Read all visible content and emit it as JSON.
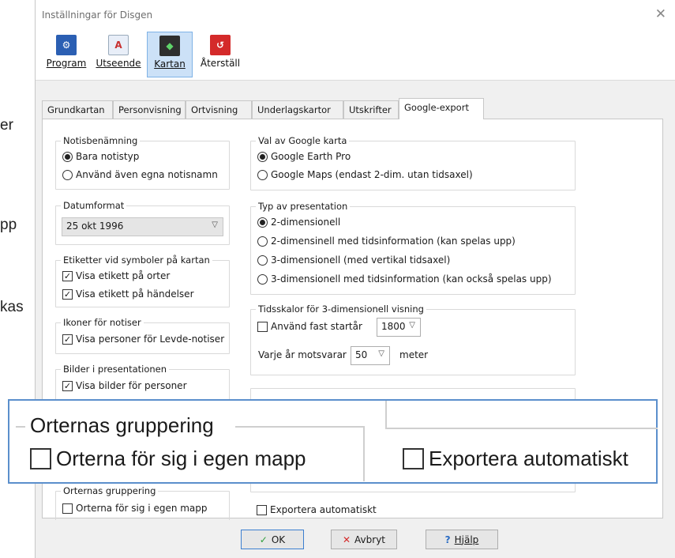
{
  "background_fragments": [
    "er",
    "pp",
    "kas"
  ],
  "window": {
    "title": "Inställningar för Disgen",
    "close_glyph": "✕"
  },
  "toolbar": [
    {
      "label": "Program",
      "icon": "gears-icon",
      "glyph": "⚙",
      "color": "#2b5fb3"
    },
    {
      "label": "Utseende",
      "icon": "appearance-icon",
      "glyph": "A",
      "color": "#c83030"
    },
    {
      "label": "Kartan",
      "icon": "map-icon",
      "glyph": "◆",
      "color": "#1e8a3a",
      "active": true
    },
    {
      "label": "Återställ",
      "icon": "reset-icon",
      "glyph": "↺",
      "color": "#d42a2a"
    }
  ],
  "tabs": [
    "Grundkartan",
    "Personvisning",
    "Ortvisning",
    "Underlagskartor",
    "Utskrifter",
    "Google-export"
  ],
  "selected_tab": "Google-export",
  "groups": {
    "notis": {
      "title": "Notisbenämning",
      "options": [
        "Bara notistyp",
        "Använd även egna notisnamn"
      ],
      "selected": 0
    },
    "datum": {
      "title": "Datumformat",
      "value": "25 okt 1996"
    },
    "etiketter": {
      "title": "Etiketter vid symboler på kartan",
      "options": [
        "Visa etikett på orter",
        "Visa etikett på händelser"
      ]
    },
    "ikoner": {
      "title": "Ikoner för notiser",
      "options": [
        "Visa personer för Levde-notiser"
      ]
    },
    "bilder": {
      "title": "Bilder i presentationen",
      "options": [
        "Visa bilder för personer"
      ]
    },
    "google_map": {
      "title": "Val av Google karta",
      "options": [
        "Google Earth Pro",
        "Google Maps (endast 2-dim. utan tidsaxel)"
      ],
      "selected": 0
    },
    "presentation": {
      "title": "Typ av presentation",
      "options": [
        "2-dimensionell",
        "2-dimensinell med tidsinformation (kan spelas upp)",
        "3-dimensionell (med vertikal tidsaxel)",
        "3-dimensionell med tidsinformation (kan också spelas upp)"
      ],
      "selected": 0
    },
    "tidsskalor": {
      "title": "Tidsskalor för 3-dimensionell visning",
      "fixed_label": "Använd fast startår",
      "fixed_year": "1800",
      "scale_label": "Varje år motsvarar",
      "scale_value": "50",
      "unit": "meter"
    },
    "orternas": {
      "title": "Orternas gruppering",
      "option": "Orterna för sig i egen mapp"
    },
    "export_auto": "Exportera automatiskt"
  },
  "zoom_callout": {
    "title": "Orternas gruppering",
    "option_left": "Orterna för sig i egen mapp",
    "option_right": "Exportera automatiskt"
  },
  "buttons": {
    "ok": "OK",
    "cancel": "Avbryt",
    "help": "Hjälp"
  }
}
